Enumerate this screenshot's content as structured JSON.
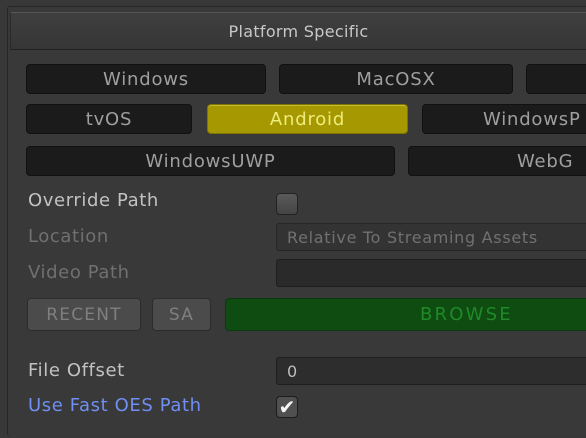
{
  "section": {
    "title": "Platform Specific"
  },
  "platform_tabs": {
    "windows": "Windows",
    "macosx": "MacOSX",
    "ios": "",
    "tvos": "tvOS",
    "android": "Android",
    "windowsphone": "WindowsP",
    "windowsuwp": "WindowsUWP",
    "webgl": "WebG",
    "selected": "Android"
  },
  "properties": {
    "override_path": {
      "label": "Override Path",
      "checked": false
    },
    "location": {
      "label": "Location",
      "value": "Relative To Streaming Assets"
    },
    "video_path": {
      "label": "Video Path",
      "value": ""
    },
    "file_offset": {
      "label": "File Offset",
      "value": "0"
    },
    "use_fast_oes_path": {
      "label": "Use Fast OES Path",
      "checked": true,
      "check_glyph": "✔"
    }
  },
  "buttons": {
    "recent": "RECENT",
    "sa": "SA",
    "browse": "BROWSE"
  },
  "colors": {
    "active_tab": "#a59800",
    "browse_button": "#0e4c12",
    "highlight_label": "#6f8ff3"
  }
}
